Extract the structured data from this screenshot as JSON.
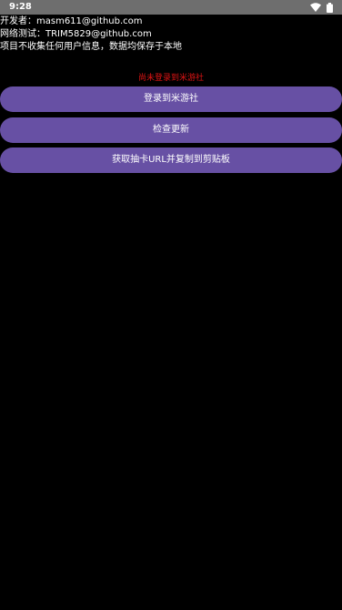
{
  "statusbar": {
    "time": "9:28",
    "icons": [
      "wifi-icon",
      "battery-icon"
    ],
    "background": "#6e6e6e"
  },
  "info": {
    "developer": "开发者：masm611@github.com",
    "network_test": "网络测试：TRIM5829@github.com",
    "privacy": "项目不收集任何用户信息，数据均保存于本地"
  },
  "status_message": "尚未登录到米游社",
  "buttons": {
    "login": "登录到米游社",
    "check_update": "检查更新",
    "gacha_url": "获取抽卡URL并复制到剪贴板"
  },
  "colors": {
    "background": "#000000",
    "button": "#6750a4",
    "status_message": "#e01414",
    "text": "#ffffff"
  }
}
